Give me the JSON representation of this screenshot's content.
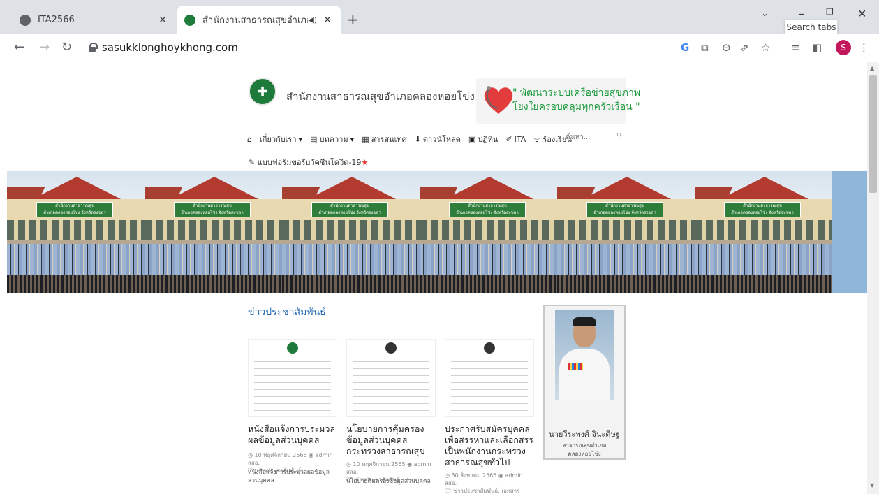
{
  "browser": {
    "tabs": [
      {
        "title": "ITA2566",
        "active": false
      },
      {
        "title": "สำนักงานสาธารณสุขอำเภอคลองหอยโข่ง",
        "active": true
      }
    ],
    "new_tab": "+",
    "tab_search_tooltip": "Search tabs",
    "url": "sasukklonghoykhong.com",
    "profile_initial": "S"
  },
  "site": {
    "name": "สำนักงานสาธารณสุขอำเภอคลองหอยโข่ง",
    "slogan_line1": "\" พัฒนาระบบเครือข่ายสุขภาพ",
    "slogan_line2": "โยงใยครอบคลุมทุกครัวเรือน \""
  },
  "menu": [
    {
      "label": "",
      "icon": "home-icon"
    },
    {
      "label": "เกี่ยวกับเรา",
      "icon": "chevron-down-icon"
    },
    {
      "label": "บทความ",
      "icon": "article-icon"
    },
    {
      "label": "สารสนเทศ",
      "icon": "document-icon"
    },
    {
      "label": "ดาวน์โหลด",
      "icon": "download-icon"
    },
    {
      "label": "ปฏิทิน",
      "icon": "calendar-icon"
    },
    {
      "label": "ITA",
      "icon": "pin-icon"
    },
    {
      "label": "ร้องเรียน",
      "icon": "rss-icon"
    }
  ],
  "search": {
    "placeholder": "ค้นหา..."
  },
  "menu_row2": "แบบฟอร์มขอรับวัคซีนโควิด-19",
  "hero": {
    "sign_line1": "สำนักงานสาธารณสุข",
    "sign_line2": "อำเภอคลองหอยโข่ง จังหวัดสงขลา",
    "panels": 6
  },
  "news": {
    "section_title": "ข่าวประชาสัมพันธ์",
    "items": [
      {
        "title": "หนังสือแจ้งการประมวลผลข้อมูลส่วนบุคคล",
        "date": "10 พฤศจิกายน 2565",
        "author": "admin สสอ.",
        "category": "ข่าวประชาสัมพันธ์",
        "excerpt": "หนังสือแจ้งการประมวลผลข้อมูลส่วนบุคคล"
      },
      {
        "title": "นโยบายการคุ้มครองข้อมูลส่วนบุคคล กระทรวงสาธารณสุข",
        "date": "10 พฤศจิกายน 2565",
        "author": "admin สสอ.",
        "category": "ข่าวประชาสัมพันธ์",
        "excerpt": "นโยบายคุ้มครองข้อมูลส่วนบุคคล"
      },
      {
        "title": "ประกาศรับสมัครบุคคลเพื่อสรรหาและเลือกสรรเป็นพนักงานกระทรวงสาธารณสุขทั่วไป",
        "date": "30 สิงหาคม 2565",
        "author": "admin สสอ.",
        "category": "ข่าวประชาสัมพันธ์, เอกสารดาวน์โหลด",
        "excerpt": ""
      }
    ]
  },
  "profile": {
    "name": "นายวีระพงศ์ จินะดิษฐ",
    "role_line1": "สาธารณสุขอำเภอ",
    "role_line2": "คลองหอยโข่ง"
  },
  "colors": {
    "brand_green": "#1d7a3a",
    "link_blue": "#2f6fb5",
    "slogan_green": "#1a9a3c"
  }
}
